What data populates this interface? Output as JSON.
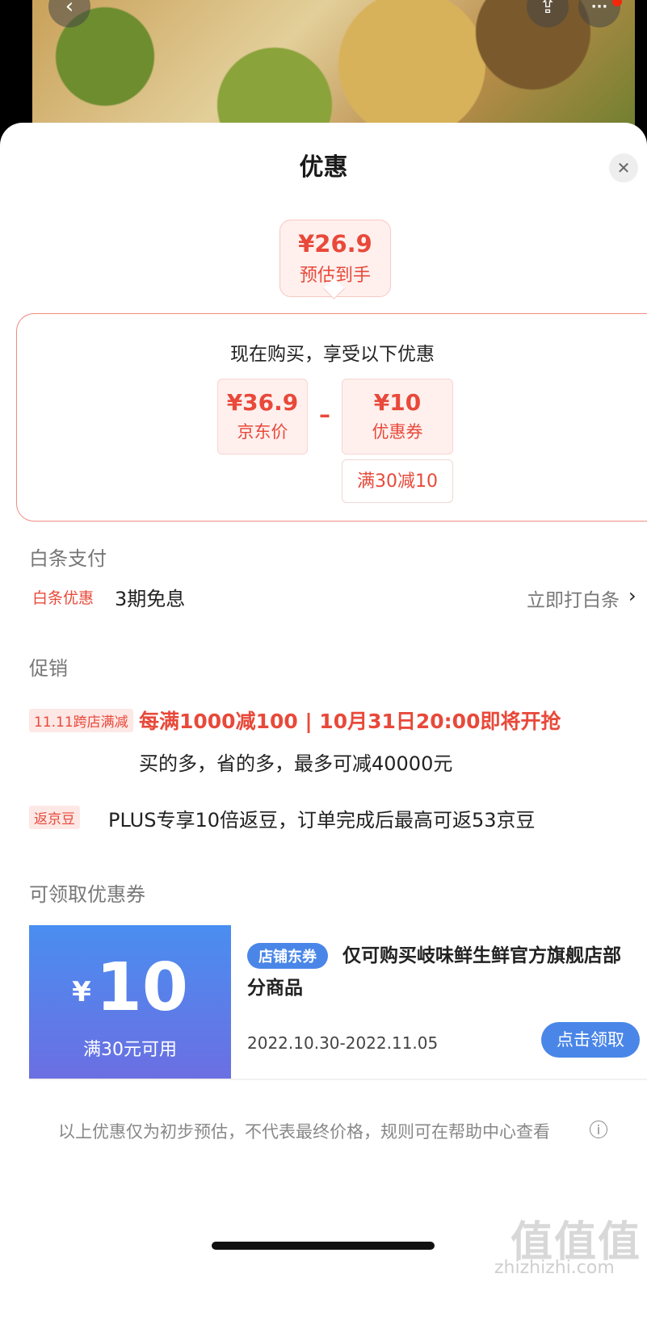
{
  "top_bar": {
    "back_icon": "‹",
    "share_icon": "⇪",
    "more_icon": "···"
  },
  "sheet": {
    "title": "优惠",
    "close_icon": "✕"
  },
  "estimate": {
    "price": "¥26.9",
    "label": "预估到手"
  },
  "detail": {
    "heading": "现在购买，享受以下优惠",
    "jd_price": "¥36.9",
    "jd_label": "京东价",
    "minus": "–",
    "coupon_value": "¥10",
    "coupon_label": "优惠券",
    "coupon_condition": "满30减10"
  },
  "baitiao": {
    "section": "白条支付",
    "tag": "白条优惠",
    "text": "3期免息",
    "link": "立即打白条",
    "chevron": "›"
  },
  "promo": {
    "section": "促销",
    "tag1": "11.11跨店满减",
    "highlight": "每满1000减100 | 10月31日20:00即将开抢",
    "sub": "买的多，省的多，最多可减40000元",
    "tag2": "返京豆",
    "bean_text": "PLUS专享10倍返豆，订单完成后最高可返53京豆"
  },
  "coupons": {
    "section": "可领取优惠券",
    "currency": "¥",
    "amount": "10",
    "condition": "满30元可用",
    "badge": "店铺东券",
    "description": "仅可购买岐味鲜生鲜官方旗舰店部分商品",
    "date_range": "2022.10.30-2022.11.05",
    "claim": "点击领取"
  },
  "footnote": {
    "text": "以上优惠仅为初步预估，不代表最终价格，规则可在帮助中心查看",
    "info_icon": "i"
  },
  "watermark": {
    "logo": "值值值",
    "url": "zhizhizhi.com"
  },
  "colors": {
    "accent_red": "#e8493a",
    "coupon_blue": "#4a86e8"
  }
}
